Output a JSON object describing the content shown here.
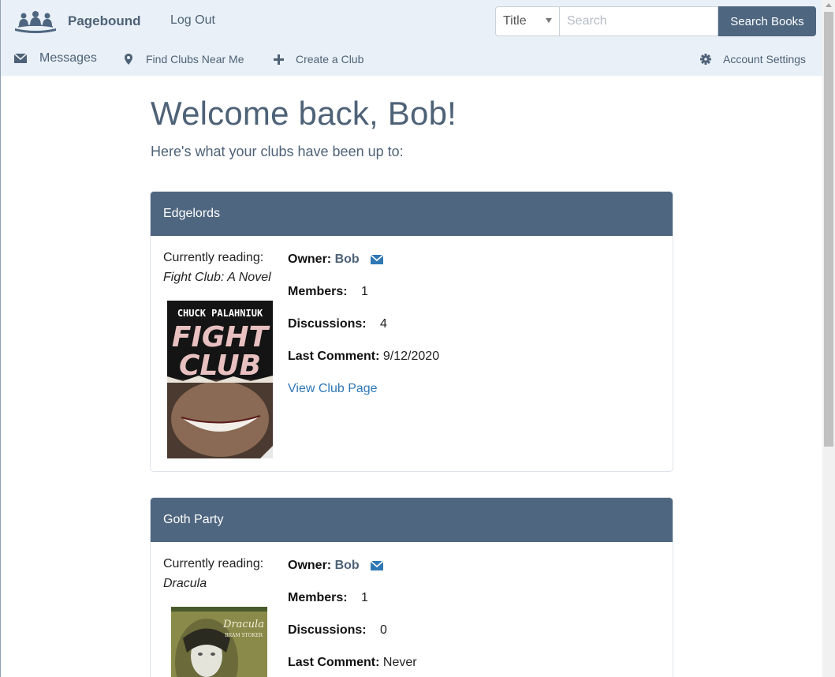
{
  "navbar": {
    "brand_name": "Pagebound",
    "logout_label": "Log Out",
    "search": {
      "field_selected": "Title",
      "placeholder": "Search",
      "value": "",
      "button_label": "Search Books"
    },
    "subnav": {
      "messages_label": "Messages",
      "find_clubs_label": "Find Clubs Near Me",
      "create_club_label": "Create a Club",
      "account_settings_label": "Account Settings"
    }
  },
  "page": {
    "welcome": "Welcome back, Bob!",
    "subtitle": "Here's what your clubs have been up to:"
  },
  "labels": {
    "currently_reading": "Currently reading:",
    "owner": "Owner:",
    "members": "Members:",
    "discussions": "Discussions:",
    "last_comment": "Last Comment:",
    "view_club": "View Club Page"
  },
  "clubs": [
    {
      "name": "Edgelords",
      "book_title": "Fight Club: A Novel",
      "cover_lettering": [
        "CHUCK PALAHNIUK",
        "FIGHT",
        "CLUB"
      ],
      "owner": "Bob",
      "members": "1",
      "discussions": "4",
      "last_comment": "9/12/2020"
    },
    {
      "name": "Goth Party",
      "book_title": "Dracula",
      "cover_lettering": [
        "Dracula",
        "BRAM STOKER"
      ],
      "owner": "Bob",
      "members": "1",
      "discussions": "0",
      "last_comment": "Never"
    }
  ],
  "colors": {
    "navbar_bg": "#e9f0f7",
    "brand_text": "#4e6277",
    "card_header": "#4f6680",
    "link_blue": "#2f78b5",
    "mail_icon": "#2f78b5"
  }
}
